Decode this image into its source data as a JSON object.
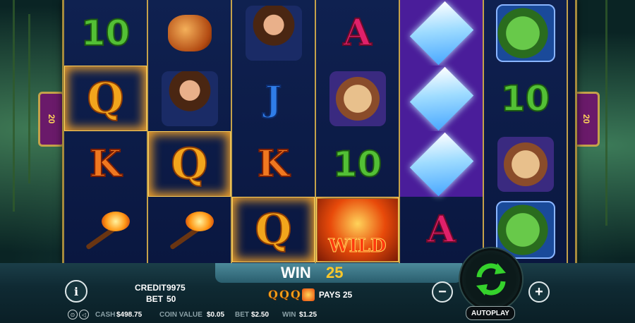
{
  "reels": [
    [
      {
        "sym": "ten",
        "text": "10",
        "win": false
      },
      {
        "sym": "q",
        "text": "Q",
        "win": true
      },
      {
        "sym": "k",
        "text": "K",
        "win": false
      },
      {
        "sym": "torch",
        "text": "",
        "win": false
      }
    ],
    [
      {
        "sym": "amber",
        "text": "",
        "win": false
      },
      {
        "sym": "woman",
        "text": "",
        "win": false
      },
      {
        "sym": "q",
        "text": "Q",
        "win": true
      },
      {
        "sym": "torch",
        "text": "",
        "win": false
      }
    ],
    [
      {
        "sym": "woman",
        "text": "",
        "win": false
      },
      {
        "sym": "j",
        "text": "J",
        "win": false
      },
      {
        "sym": "k",
        "text": "K",
        "win": false
      },
      {
        "sym": "q",
        "text": "Q",
        "win": true
      }
    ],
    [
      {
        "sym": "a",
        "text": "A",
        "win": false
      },
      {
        "sym": "cat",
        "text": "",
        "win": false
      },
      {
        "sym": "ten",
        "text": "10",
        "win": false
      },
      {
        "sym": "wild",
        "text": "WILD",
        "win": true
      }
    ],
    [
      {
        "sym": "diamond",
        "text": "",
        "win": false
      },
      {
        "sym": "diamond",
        "text": "",
        "win": false
      },
      {
        "sym": "diamond",
        "text": "",
        "win": false
      },
      {
        "sym": "a",
        "text": "A",
        "win": false
      }
    ],
    [
      {
        "sym": "dino",
        "text": "",
        "win": false
      },
      {
        "sym": "ten",
        "text": "10",
        "win": false
      },
      {
        "sym": "cat",
        "text": "",
        "win": false
      },
      {
        "sym": "dino",
        "text": "",
        "win": false
      }
    ]
  ],
  "win": {
    "label": "WIN",
    "amount": "25"
  },
  "credit": {
    "label": "CREDIT",
    "value": "9975"
  },
  "bet": {
    "label": "BET",
    "value": "50"
  },
  "pays_label": "PAYS 25",
  "pays_symbols": [
    "Q",
    "Q",
    "Q",
    "WILD"
  ],
  "info_row": {
    "cash_label": "CASH",
    "cash_value": "$498.75",
    "coin_label": "COIN VALUE",
    "coin_value": "$0.05",
    "bet_label": "BET",
    "bet_value": "$2.50",
    "win_label": "WIN",
    "win_value": "$1.25"
  },
  "buttons": {
    "info": "i",
    "minus": "−",
    "plus": "+",
    "autoplay": "AUTOPLAY"
  },
  "side_tab_text": "20"
}
